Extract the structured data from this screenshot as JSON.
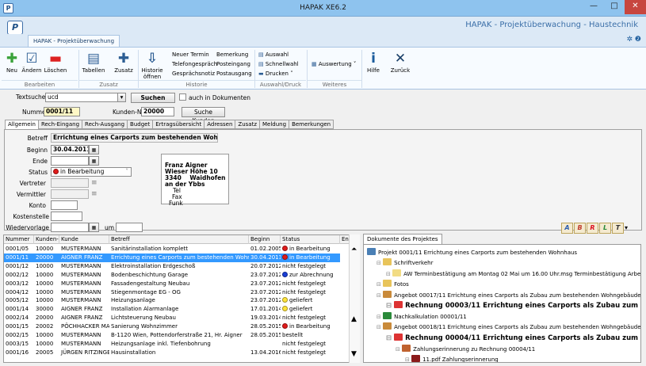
{
  "window": {
    "title": "HAPAK XE6.2",
    "min": "—",
    "max": "□",
    "close": "✕"
  },
  "app": {
    "title": "HAPAK - Projektüberwachung - Haustechnik",
    "logo": "P"
  },
  "ribbon": {
    "tab": "HAPAK - Projektüberwachung",
    "help_icons": "✲ ❷",
    "buttons": {
      "neu": "Neu",
      "aendern": "Ändern",
      "loeschen": "Löschen",
      "tabellen": "Tabellen",
      "zusatz": "Zusatz",
      "historie_1": "Historie",
      "historie_2": "öffnen",
      "hilfe": "Hilfe",
      "zurueck": "Zurück",
      "auswertung": "Auswertung"
    },
    "small": {
      "neuer_termin": "Neuer Termin",
      "telefon": "Telefongespräch",
      "notiz": "Gesprächsnotiz",
      "bemerkung": "Bemerkung",
      "post_eing": "Posteingang",
      "post_ausg": "Postausgang",
      "auswahl": "Auswahl",
      "schnellwahl": "Schnellwahl",
      "drucken": "Drucken"
    },
    "groups": {
      "bearbeiten": "Bearbeiten",
      "zusatz": "Zusatz",
      "historie": "Historie",
      "auswahl": "Auswahl/Druck",
      "weiteres": "Weiteres"
    }
  },
  "search": {
    "label": "Textsuche",
    "value": "ucd",
    "button": "Suchen",
    "checkbox": "auch in Dokumenten"
  },
  "header": {
    "nummer_label": "Nummer",
    "nummer": "0001/11",
    "kunden_label": "Kunden-Nr",
    "kunden_nr": "20000",
    "suche_kunden": "Suche Kunden"
  },
  "tabs": [
    "Allgemein",
    "Rech-Eingang",
    "Rech-Ausgang",
    "Budget",
    "Ertragsübersicht",
    "Adressen",
    "Zusatz",
    "Meldung",
    "Bemerkungen"
  ],
  "form": {
    "betreff_label": "Betreff",
    "betreff": "Errichtung eines Carports zum bestehenden Wohnhaus",
    "beginn_label": "Beginn",
    "beginn": "30.04.2011",
    "ende_label": "Ende",
    "ende": "",
    "status_label": "Status",
    "status": "in Bearbeitung",
    "vertreter_label": "Vertreter",
    "vermittler_label": "Vermittler",
    "konto_label": "Konto",
    "kostenstelle_label": "Kostenstelle",
    "wiedervorlage_label": "Wiedervorlage",
    "um_label": "um"
  },
  "address": {
    "name": "Franz Aigner",
    "street": "Wieser Höhe 10",
    "zip": "3340",
    "city": "Waidhofen an der Ybbs",
    "tel": "Tel",
    "fax": "Fax",
    "funk": "Funk"
  },
  "table": {
    "columns": [
      "Nummer",
      "Kunden-N",
      "Kunde",
      "Betreff",
      "Beginn",
      "Status",
      "En"
    ],
    "rows": [
      [
        "0001/05",
        "10000",
        "MUSTERMANN",
        "Sanitärinstallation komplett",
        "01.02.2005",
        "in Bearbeitung",
        "red"
      ],
      [
        "0001/11",
        "20000",
        "AIGNER FRANZ",
        "Errichtung eines Carports zum bestehenden Wohnhaus",
        "30.04.2011",
        "in Bearbeitung",
        "red"
      ],
      [
        "0001/12",
        "10000",
        "MUSTERMANN",
        "Elektroinstallation Erdgeschoß",
        "20.07.2012",
        "nicht festgelegt",
        ""
      ],
      [
        "0002/12",
        "10000",
        "MUSTERMANN",
        "Bodenbeschichtung Garage",
        "23.07.2012",
        "zur Abrechnung",
        "blue"
      ],
      [
        "0003/12",
        "10000",
        "MUSTERMANN",
        "Fassadengestaltung Neubau",
        "23.07.2012",
        "nicht festgelegt",
        ""
      ],
      [
        "0004/12",
        "10000",
        "MUSTERMANN",
        "Stiegenmontage EG - OG",
        "23.07.2012",
        "nicht festgelegt",
        ""
      ],
      [
        "0005/12",
        "10000",
        "MUSTERMANN",
        "Heizungsanlage",
        "23.07.2012",
        "geliefert",
        "yellow"
      ],
      [
        "0001/14",
        "30000",
        "AIGNER FRANZ",
        "Installation Alarmanlage",
        "17.01.2014",
        "geliefert",
        "yellow"
      ],
      [
        "0002/14",
        "20000",
        "AIGNER FRANZ",
        "Lichtsteuerung Neubau",
        "19.03.2014",
        "nicht festgelegt",
        ""
      ],
      [
        "0001/15",
        "20002",
        "PÖCHHACKER MAG",
        "Sanierung Wohnzimmer",
        "28.05.2015",
        "in Bearbeitung",
        "red"
      ],
      [
        "0002/15",
        "10000",
        "MUSTERMANN",
        "B-1120 Wien, Pottendorferstraße 21, Hr. Aigner",
        "28.05.2015",
        "bestellt",
        ""
      ],
      [
        "0003/15",
        "10000",
        "MUSTERMANN",
        "Heizungsanlage inkl. Tiefenbohrung",
        "",
        "nicht festgelegt",
        ""
      ],
      [
        "0001/16",
        "20005",
        "JÜRGEN RITZINGE",
        "Hausinstallation",
        "13.04.2016",
        "nicht festgelegt",
        ""
      ]
    ],
    "selected_index": 1
  },
  "tree": {
    "tab": "Dokumente des Projektes",
    "nodes": [
      {
        "text": "Projekt 0001/11 Errichtung eines Carports zum bestehenden Wohnhaus",
        "level": 0,
        "big": false,
        "icon": "#4a7fb5"
      },
      {
        "text": "Schriftverkehr",
        "level": 1,
        "big": false,
        "icon": "#e8c45a"
      },
      {
        "text": "AW  Terminbestätigung am Montag 02  Mai um 16.00 Uhr.msg Terminbestätigung Arbeitsbeginn am",
        "level": 2,
        "big": false,
        "icon": "#f2dc84"
      },
      {
        "text": "Fotos",
        "level": 1,
        "big": false,
        "icon": "#e8c45a"
      },
      {
        "text": "Angebot 00017/11 Errichtung eines Carports als Zubau zum bestehenden Wohngebäude",
        "level": 1,
        "big": false,
        "icon": "#c98a3a"
      },
      {
        "text": "Rechnung 00003/11 Errichtung eines Carports als Zubau zum bestehenden Wohnh",
        "level": 2,
        "big": true,
        "icon": "#d33"
      },
      {
        "text": "Nachkalkulation 00001/11",
        "level": 1,
        "big": false,
        "icon": "#2a8a3a"
      },
      {
        "text": "Angebot 00018/11 Errichtung eines Carports als Zubau zum bestehenden Wohngebäude",
        "level": 1,
        "big": false,
        "icon": "#c98a3a"
      },
      {
        "text": "Rechnung 00004/11 Errichtung eines Carports als Zubau zum bestehenden Wohnh",
        "level": 2,
        "big": true,
        "icon": "#d33"
      },
      {
        "text": "Zahlungserinnerung zu Rechnung 00004/11",
        "level": 3,
        "big": false,
        "icon": "#c0622f"
      },
      {
        "text": "11.pdf Zahlungserinnerung",
        "level": 4,
        "big": false,
        "icon": "#8b1a1a"
      }
    ]
  },
  "colors": {
    "red": "#e01b1b",
    "blue": "#1a3fd6",
    "yellow": "#ffe43a",
    "selected": "#3399ff"
  }
}
